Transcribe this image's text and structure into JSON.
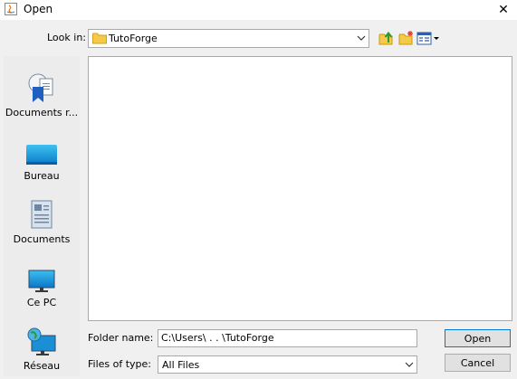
{
  "window": {
    "title": "Open",
    "close_glyph": "✕"
  },
  "look_in": {
    "label": "Look in:",
    "value": "TutoForge"
  },
  "places": [
    {
      "label": "Documents r...",
      "icon": "recent-documents-icon"
    },
    {
      "label": "Bureau",
      "icon": "desktop-icon"
    },
    {
      "label": "Documents",
      "icon": "documents-icon"
    },
    {
      "label": "Ce PC",
      "icon": "computer-icon"
    },
    {
      "label": "Réseau",
      "icon": "network-icon"
    }
  ],
  "folder_name": {
    "label": "Folder name:",
    "value": "C:\\Users\\          .        .        \\TutoForge"
  },
  "file_type": {
    "label": "Files of type:",
    "value": "All Files"
  },
  "buttons": {
    "open": "Open",
    "cancel": "Cancel"
  },
  "colors": {
    "accent": "#0078d7",
    "folder": "#f7c948"
  }
}
